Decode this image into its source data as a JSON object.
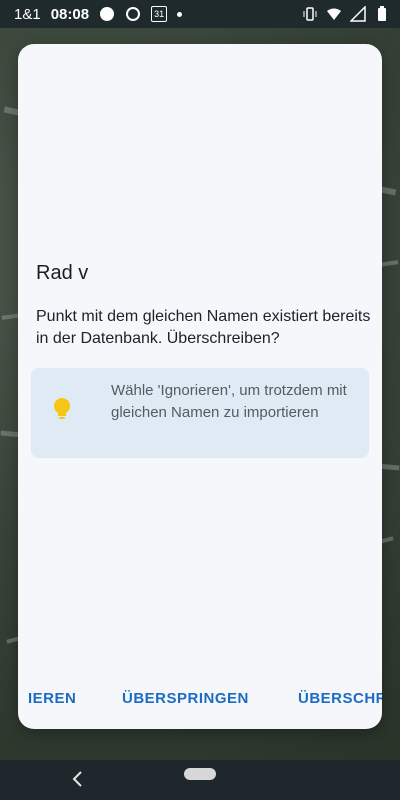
{
  "status_bar": {
    "carrier": "1&1",
    "time": "08:08",
    "calendar_day": "31"
  },
  "dialog": {
    "title": "Rad v",
    "message": "Punkt mit dem gleichen Namen existiert bereits in der Datenbank. Überschreiben?",
    "hint": "Wähle 'Ignorieren', um trotzdem mit gleichen Namen zu importieren",
    "buttons": {
      "ignore": "IEREN",
      "skip": "ÜBERSPRINGEN",
      "overwrite": "ÜBERSCHR"
    }
  },
  "icons": [
    "lightbulb-icon",
    "vibrate-icon",
    "wifi-icon",
    "signal-icon",
    "battery-icon",
    "back-icon",
    "home-pill"
  ],
  "colors": {
    "accent": "#1c6cc3",
    "dialog_bg": "#f5f7fa",
    "hint_bg": "#e0eaf4",
    "bulb": "#f5c518"
  }
}
